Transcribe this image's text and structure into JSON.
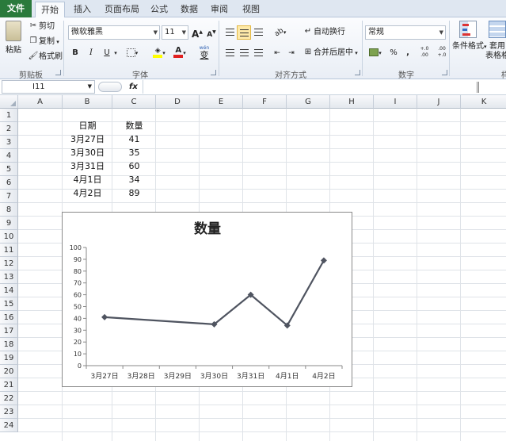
{
  "tabs": [
    {
      "label": "文件",
      "active": false
    },
    {
      "label": "开始",
      "active": true
    },
    {
      "label": "插入",
      "active": false
    },
    {
      "label": "页面布局",
      "active": false
    },
    {
      "label": "公式",
      "active": false
    },
    {
      "label": "数据",
      "active": false
    },
    {
      "label": "审阅",
      "active": false
    },
    {
      "label": "视图",
      "active": false
    }
  ],
  "ribbon": {
    "clipboard": {
      "paste_label": "粘贴",
      "cut_label": "剪切",
      "copy_label": "复制",
      "format_painter_label": "格式刷",
      "group_label": "剪贴板"
    },
    "font": {
      "font_name": "微软雅黑",
      "font_size": "11",
      "grow_label": "A",
      "shrink_label": "A",
      "bold_label": "B",
      "italic_label": "I",
      "underline_label": "U",
      "font_color_label": "A",
      "phonetic_label": "wén",
      "phonetic_char": "变",
      "group_label": "字体"
    },
    "alignment": {
      "wrap_text_label": "自动换行",
      "merge_center_label": "合并后居中",
      "group_label": "对齐方式"
    },
    "number": {
      "format_value": "常规",
      "percent_label": "%",
      "comma_label": ",",
      "increase_decimal_label": "+.0 .00",
      "decrease_decimal_label": ".00 +.0",
      "group_label": "数字"
    },
    "styles": {
      "conditional_format_label": "条件格式",
      "table_format_label_line1": "套用",
      "table_format_label_line2": "表格格",
      "group_label_partial": "样"
    }
  },
  "formula_bar": {
    "name_box": "I11",
    "fx_label": "fx",
    "formula_value": ""
  },
  "columns": [
    "A",
    "B",
    "C",
    "D",
    "E",
    "F",
    "G",
    "H",
    "I",
    "J",
    "K"
  ],
  "rows": [
    "1",
    "2",
    "3",
    "4",
    "5",
    "6",
    "7",
    "8",
    "9",
    "10",
    "11",
    "12",
    "13",
    "14",
    "15",
    "16",
    "17",
    "18",
    "19",
    "20",
    "21",
    "22",
    "23",
    "24"
  ],
  "table": {
    "headers": [
      "日期",
      "数量"
    ],
    "rows": [
      [
        "3月27日",
        "41"
      ],
      [
        "3月30日",
        "35"
      ],
      [
        "3月31日",
        "60"
      ],
      [
        "4月1日",
        "34"
      ],
      [
        "4月2日",
        "89"
      ]
    ]
  },
  "colors": {
    "file_tab": "#2a7a3c",
    "series_line": "#4f5460",
    "pressed_button": "#fde9a8"
  },
  "chart_data": {
    "type": "line",
    "title": "数量",
    "x": [
      "3月27日",
      "3月28日",
      "3月29日",
      "3月30日",
      "3月31日",
      "4月1日",
      "4月2日"
    ],
    "points": [
      {
        "x": "3月27日",
        "y": 41
      },
      {
        "x": "3月30日",
        "y": 35
      },
      {
        "x": "3月31日",
        "y": 60
      },
      {
        "x": "4月1日",
        "y": 34
      },
      {
        "x": "4月2日",
        "y": 89
      }
    ],
    "yticks": [
      "0",
      "10",
      "20",
      "30",
      "40",
      "50",
      "60",
      "70",
      "80",
      "90",
      "100"
    ],
    "ylim": [
      0,
      100
    ],
    "xaxis_type": "date",
    "marker": "diamond",
    "grid": false,
    "legend": "none"
  }
}
